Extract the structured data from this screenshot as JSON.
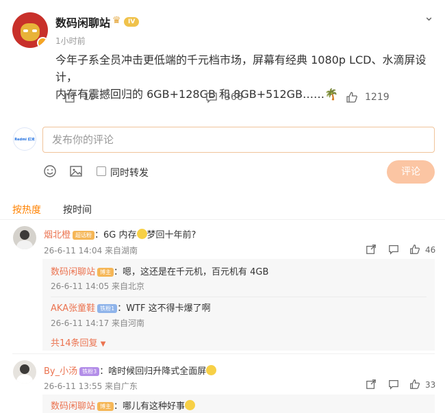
{
  "post": {
    "author": "数码闲聊站",
    "level": "IV",
    "time": "1小时前",
    "text_line1": "今年子系全员冲击更低端的千元档市场，屏幕有经典 1080p LCD、水滴屏设计，",
    "text_line2": "内存有震撼回归的 6GB+128GB 和 8GB+512GB……",
    "reposts": "19",
    "comments": "366",
    "likes": "1219"
  },
  "compose": {
    "avatar_text": "Redmi 红米",
    "placeholder": "发布你的评论",
    "repost_label": "同时转发",
    "submit_label": "评论"
  },
  "sort": {
    "hot": "按热度",
    "time": "按时间"
  },
  "comments": [
    {
      "name": "烟北橙",
      "badge": "超话粉",
      "text_pre": "：6G 内存",
      "text_post": "梦回十年前?",
      "meta": "26-6-11 14:04 来自湖南",
      "likes": "46",
      "replies": [
        {
          "name": "数码闲聊站",
          "badge": "博主",
          "text": "：嗯，这还是在千元机，百元机有 4GB",
          "meta": "26-6-11 14:05 来自北京"
        },
        {
          "name": "AKA张童鞋",
          "badge": "铁粉1",
          "text": "：WTF 这不得卡爆了啊",
          "meta": "26-6-11 14:17 来自河南"
        }
      ],
      "more_replies": "共14条回复"
    },
    {
      "name": "By_小汤",
      "badge": "铁粉3",
      "text": "：啥时候回归升降式全面屏",
      "meta": "26-6-11 13:55 来自广东",
      "likes": "33",
      "replies": [
        {
          "name": "数码闲聊站",
          "badge": "博主",
          "text": "：哪儿有这种好事"
        }
      ]
    }
  ],
  "colors": {
    "accent": "#ff8200",
    "link": "#eb7350",
    "submit_bg": "#fbc5a3"
  }
}
